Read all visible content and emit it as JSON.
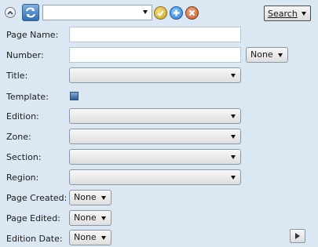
{
  "toolbar": {
    "query_value": "",
    "search_label": "Search",
    "colors": {
      "accept": "#c9a227",
      "add": "#2f7fd1",
      "cancel": "#c06030"
    }
  },
  "form": {
    "page_name_label": "Page Name:",
    "page_name_value": "",
    "number_label": "Number:",
    "number_value": "",
    "number_option": "None",
    "title_label": "Title:",
    "template_label": "Template:",
    "edition_label": "Edition:",
    "zone_label": "Zone:",
    "section_label": "Section:",
    "region_label": "Region:",
    "page_created_label": "Page Created:",
    "page_created_option": "None",
    "page_edited_label": "Page Edited:",
    "page_edited_option": "None",
    "edition_date_label": "Edition Date:",
    "edition_date_option": "None"
  },
  "icons": {
    "collapse": "chevron-up-icon",
    "refresh": "refresh-icon",
    "accept": "checkmark-icon",
    "add": "plus-icon",
    "cancel": "close-icon",
    "play": "play-icon"
  }
}
